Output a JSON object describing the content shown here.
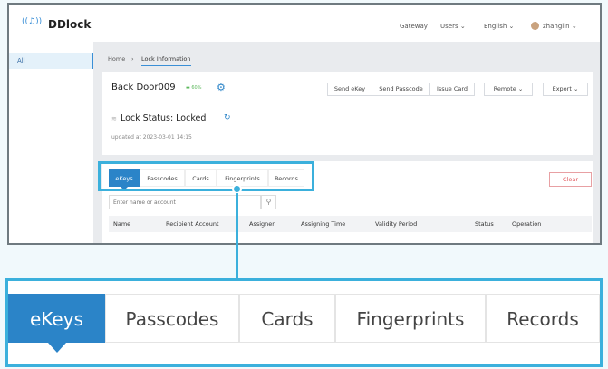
{
  "app": {
    "name": "DDlock"
  },
  "header": {
    "nav": [
      "Gateway",
      "Users",
      "English"
    ],
    "user": "zhanglin"
  },
  "sidebar": {
    "items": [
      {
        "label": "All"
      }
    ]
  },
  "breadcrumb": {
    "home": "Home",
    "current": "Lock Information"
  },
  "lock": {
    "name": "Back Door009",
    "battery": "60%",
    "status": "Lock Status: Locked",
    "updated": "updated at 2023-03-01 14:15"
  },
  "actions": {
    "send_ekey": "Send eKey",
    "send_passcode": "Send Passcode",
    "issue_card": "Issue Card",
    "remote": "Remote",
    "export": "Export"
  },
  "tabs": [
    {
      "label": "eKeys",
      "active": true
    },
    {
      "label": "Passcodes"
    },
    {
      "label": "Cards"
    },
    {
      "label": "Fingerprints"
    },
    {
      "label": "Records"
    }
  ],
  "clear_label": "Clear",
  "search": {
    "placeholder": "Enter name or account"
  },
  "table": {
    "columns": [
      "Name",
      "Recipient Account",
      "Assigner",
      "Assigning Time",
      "Validity Period",
      "Status",
      "Operation"
    ]
  },
  "colors": {
    "accent": "#2b84c8",
    "highlight": "#3bb0dc",
    "danger": "#e0555a"
  }
}
